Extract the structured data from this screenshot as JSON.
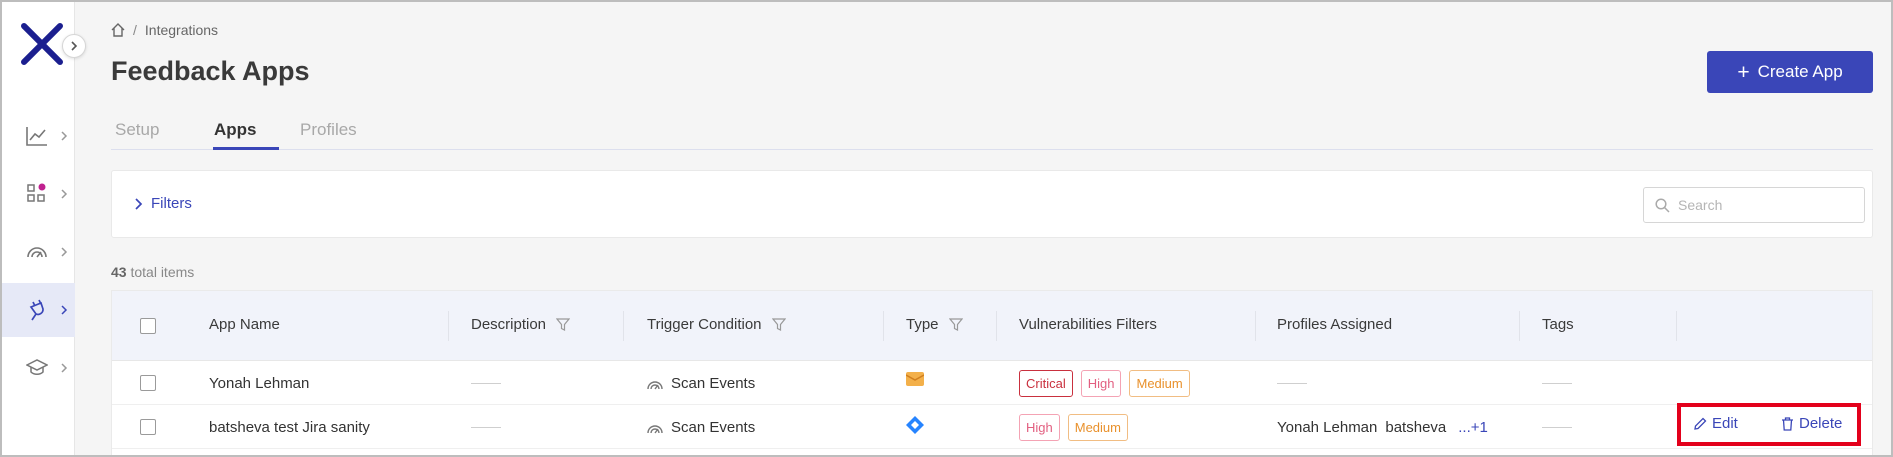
{
  "breadcrumb": {
    "home_icon": "home-icon",
    "current": "Integrations"
  },
  "page": {
    "title": "Feedback Apps",
    "create_button": "Create App"
  },
  "tabs": [
    {
      "label": "Setup",
      "active": false
    },
    {
      "label": "Apps",
      "active": true
    },
    {
      "label": "Profiles",
      "active": false
    }
  ],
  "filters": {
    "label": "Filters",
    "search_placeholder": "Search",
    "search_value": ""
  },
  "summary": {
    "count": "43",
    "suffix": "total items"
  },
  "table": {
    "columns": [
      "App Name",
      "Description",
      "Trigger Condition",
      "Type",
      "Vulnerabilities Filters",
      "Profiles Assigned",
      "Tags"
    ],
    "rows": [
      {
        "app_name": "Yonah Lehman",
        "description": "",
        "trigger": "Scan Events",
        "type_icon": "email-icon",
        "vulnerabilities": [
          "Critical",
          "High",
          "Medium"
        ],
        "profiles": [],
        "tags": ""
      },
      {
        "app_name": "batsheva test Jira sanity",
        "description": "",
        "trigger": "Scan Events",
        "type_icon": "jira-icon",
        "vulnerabilities": [
          "High",
          "Medium"
        ],
        "profiles": [
          "Yonah Lehman",
          "batsheva"
        ],
        "profiles_more": "...+1",
        "tags": "",
        "actions": {
          "edit": "Edit",
          "delete": "Delete"
        }
      }
    ]
  },
  "colors": {
    "primary": "#3a46b8",
    "logo": "#1b1f8f",
    "critical": "#c9303e",
    "high": "#e25f80",
    "medium": "#e9912c",
    "highlight_box": "#e3001b"
  }
}
